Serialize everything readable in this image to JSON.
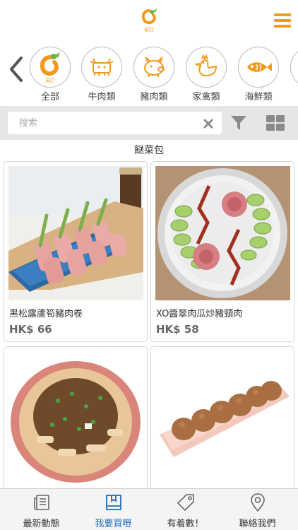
{
  "header": {
    "logo_text": "易訂",
    "logo_icon": "brand-logo-icon",
    "menu_icon": "hamburger-menu-icon",
    "accent": "#f39a1e"
  },
  "categories": [
    {
      "label": "全部",
      "icon": "brand-logo-icon"
    },
    {
      "label": "牛肉類",
      "icon": "cow-icon"
    },
    {
      "label": "豬肉類",
      "icon": "pig-icon"
    },
    {
      "label": "家禽類",
      "icon": "chicken-icon"
    },
    {
      "label": "海鮮類",
      "icon": "fish-icon"
    }
  ],
  "search": {
    "placeholder": "搜索",
    "value": ""
  },
  "section_title": "餸菜包",
  "products": [
    {
      "name": "黑松露蘆筍豬肉卷",
      "price": "HK$ 66"
    },
    {
      "name": "XO醬翠肉瓜炒豬頸肉",
      "price": "HK$ 58"
    },
    {
      "name": "",
      "price": ""
    },
    {
      "name": "",
      "price": ""
    }
  ],
  "tabs": [
    {
      "label": "最新動態",
      "icon": "news-icon",
      "active": false
    },
    {
      "label": "我要買嘢",
      "icon": "book-icon",
      "active": true
    },
    {
      "label": "有着數！",
      "icon": "tag-icon",
      "active": false
    },
    {
      "label": "聯絡我們",
      "icon": "location-pin-icon",
      "active": false
    }
  ]
}
